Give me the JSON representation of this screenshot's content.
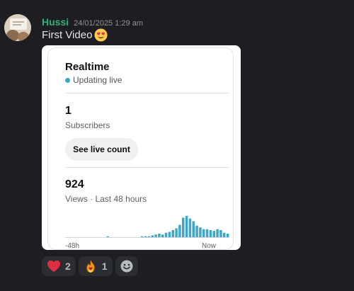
{
  "message": {
    "username": "Hussi",
    "timestamp": "24/01/2025 1:29 am",
    "text": "First Video",
    "emoji_icon": "heart-eyes-emoji-icon"
  },
  "card": {
    "title": "Realtime",
    "live_text": "Updating live",
    "subscribers": {
      "value": "1",
      "label": "Subscribers"
    },
    "button_label": "See live count",
    "views": {
      "value": "924",
      "label": "Views · Last 48 hours"
    },
    "axis_start": "-48h",
    "axis_end": "Now",
    "bar_color": "#3ea6c9",
    "hourly_views": [
      0,
      0,
      0,
      0,
      0,
      0,
      0,
      0,
      0,
      0,
      0,
      0,
      1,
      0,
      0,
      0,
      0,
      0,
      0,
      0,
      0,
      0,
      1,
      1,
      1,
      2,
      3,
      4,
      3,
      5,
      6,
      8,
      10,
      14,
      22,
      24,
      21,
      18,
      13,
      11,
      9,
      9,
      8,
      7,
      9,
      8,
      5,
      4
    ]
  },
  "reactions": [
    {
      "icon": "heart-icon",
      "count": "2"
    },
    {
      "icon": "fire-icon",
      "count": "1"
    }
  ],
  "add_reaction_icon": "add-reaction-icon"
}
